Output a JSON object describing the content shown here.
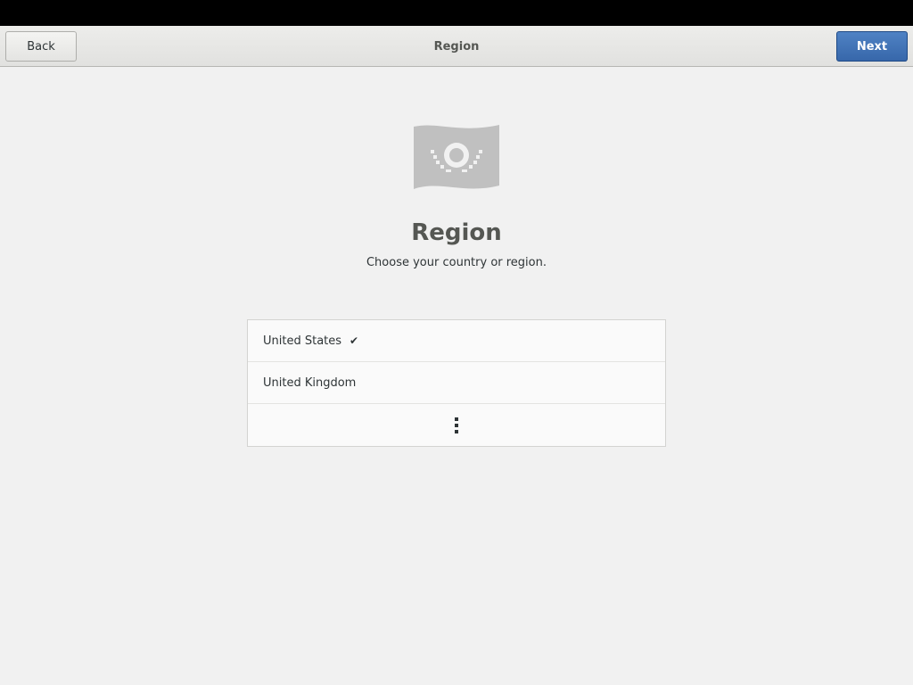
{
  "header": {
    "back_label": "Back",
    "title": "Region",
    "next_label": "Next"
  },
  "hero": {
    "icon": "flag-icon",
    "title": "Region",
    "subtitle": "Choose your country or region."
  },
  "regions": [
    {
      "label": "United States",
      "selected": true
    },
    {
      "label": "United Kingdom",
      "selected": false
    }
  ],
  "more_icon": "view-more-icon",
  "colors": {
    "accent": "#3b6cb0",
    "background": "#f1f1f1",
    "icon_gray": "#c0c0c0"
  }
}
